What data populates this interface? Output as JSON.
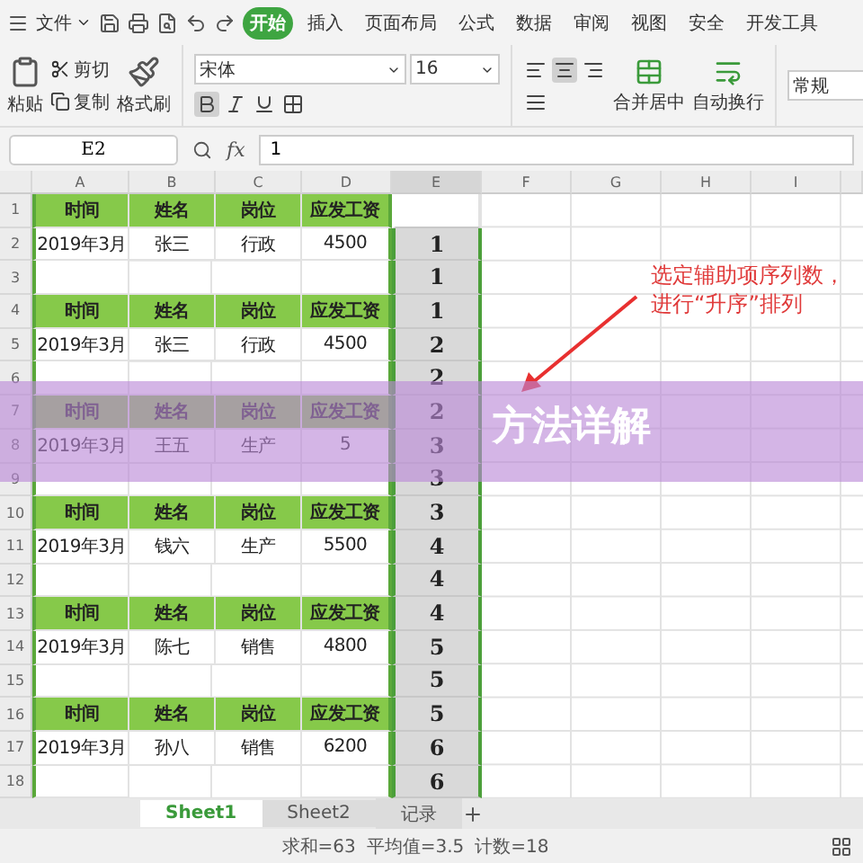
{
  "menu": {
    "file": "文件",
    "tabs": [
      {
        "label": "开始",
        "selected": true
      },
      {
        "label": "插入",
        "selected": false
      },
      {
        "label": "页面布局",
        "selected": false
      },
      {
        "label": "公式",
        "selected": false
      },
      {
        "label": "数据",
        "selected": false
      },
      {
        "label": "审阅",
        "selected": false
      },
      {
        "label": "视图",
        "selected": false
      },
      {
        "label": "安全",
        "selected": false
      },
      {
        "label": "开发工具",
        "selected": false
      }
    ]
  },
  "ribbon": {
    "paste": "粘贴",
    "cut": "剪切",
    "copy": "复制",
    "format_painter": "格式刷",
    "font": "宋体",
    "font_size": "16",
    "bold": true,
    "align_center": true,
    "merge": "合并居中",
    "wrap": "自动换行",
    "number_format": "常规"
  },
  "formula_bar": {
    "cell": "E2",
    "fx": "fx",
    "value": "1"
  },
  "columns": [
    {
      "label": "A",
      "selected": false
    },
    {
      "label": "B",
      "selected": false
    },
    {
      "label": "C",
      "selected": false
    },
    {
      "label": "D",
      "selected": false
    },
    {
      "label": "E",
      "selected": true
    },
    {
      "label": "F",
      "selected": false
    },
    {
      "label": "G",
      "selected": false
    },
    {
      "label": "H",
      "selected": false
    },
    {
      "label": "I",
      "selected": false
    }
  ],
  "rows": [
    {
      "number": "1",
      "kind": "header",
      "cells": [
        "时间",
        "姓名",
        "岗位",
        "应发工资"
      ]
    },
    {
      "number": "2",
      "kind": "data",
      "cells": [
        "2019年3月",
        "张三",
        "行政",
        "4500"
      ],
      "e": "1"
    },
    {
      "number": "3",
      "kind": "blank",
      "e": "1"
    },
    {
      "number": "4",
      "kind": "header",
      "cells": [
        "时间",
        "姓名",
        "岗位",
        "应发工资"
      ],
      "e": "1"
    },
    {
      "number": "5",
      "kind": "data",
      "cells": [
        "2019年3月",
        "张三",
        "行政",
        "4500"
      ],
      "e": "2"
    },
    {
      "number": "6",
      "kind": "blank",
      "e": "2"
    },
    {
      "number": "7",
      "kind": "header",
      "cells": [
        "时间",
        "姓名",
        "岗位",
        "应发工资"
      ],
      "e": "2"
    },
    {
      "number": "8",
      "kind": "data",
      "cells": [
        "2019年3月",
        "王五",
        "生产",
        "5"
      ],
      "e": "3"
    },
    {
      "number": "9",
      "kind": "blank",
      "e": "3"
    },
    {
      "number": "10",
      "kind": "header",
      "cells": [
        "时间",
        "姓名",
        "岗位",
        "应发工资"
      ],
      "e": "3"
    },
    {
      "number": "11",
      "kind": "data",
      "cells": [
        "2019年3月",
        "钱六",
        "生产",
        "5500"
      ],
      "e": "4"
    },
    {
      "number": "12",
      "kind": "blank",
      "e": "4"
    },
    {
      "number": "13",
      "kind": "header",
      "cells": [
        "时间",
        "姓名",
        "岗位",
        "应发工资"
      ],
      "e": "4"
    },
    {
      "number": "14",
      "kind": "data",
      "cells": [
        "2019年3月",
        "陈七",
        "销售",
        "4800"
      ],
      "e": "5"
    },
    {
      "number": "15",
      "kind": "blank",
      "e": "5"
    },
    {
      "number": "16",
      "kind": "header",
      "cells": [
        "时间",
        "姓名",
        "岗位",
        "应发工资"
      ],
      "e": "5"
    },
    {
      "number": "17",
      "kind": "data",
      "cells": [
        "2019年3月",
        "孙八",
        "销售",
        "6200"
      ],
      "e": "6"
    },
    {
      "number": "18",
      "kind": "blank",
      "e": "6"
    }
  ],
  "annotation": {
    "lines": [
      "选定辅助项序列数，",
      "进行“升序”排列"
    ]
  },
  "banner": {
    "title": "方法详解"
  },
  "sheets": [
    {
      "label": "Sheet1",
      "selected": true
    },
    {
      "label": "Sheet2",
      "selected": false
    },
    {
      "label": "记录",
      "selected": false
    }
  ],
  "status_bar": {
    "sum": "求和=63",
    "average": "平均值=3.5",
    "count": "计数=18"
  }
}
